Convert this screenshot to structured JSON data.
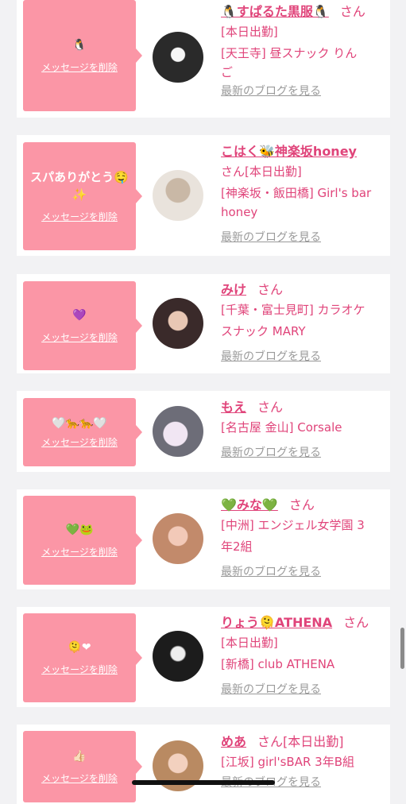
{
  "colors": {
    "accent": "#e0447a",
    "bubble": "#fb96a6",
    "muted": "#9a9a9a"
  },
  "common": {
    "delete_label": "メッセージを削除",
    "blog_label": "最新のブログを見る",
    "honorific": "さん"
  },
  "items": [
    {
      "message": "🐧",
      "name": "🐧すぱるた黒服🐧",
      "lines": [
        "[本日出勤]",
        "[天王寺] 昼スナック りん",
        "ご"
      ]
    },
    {
      "message": "スパありがとう🤤✨",
      "name": "こはく🐝神楽坂honey",
      "lines": [
        "さん[本日出勤]",
        "[神楽坂・飯田橋] Girl's bar",
        "honey"
      ]
    },
    {
      "message": "💜",
      "name": "みけ",
      "lines": [
        "[千葉・富士見町] カラオケ",
        "スナック MARY"
      ]
    },
    {
      "message": "🤍🐆🐆🤍",
      "name": "もえ",
      "lines": [
        "[名古屋 金山] Corsale"
      ]
    },
    {
      "message": "💚🐸",
      "name": "💚みな💚",
      "lines": [
        "[中洲] エンジェル女学園 3",
        "年2組"
      ]
    },
    {
      "message": "🫠❤",
      "name": "りょう🫠ATHENA",
      "lines": [
        "[本日出勤]",
        "[新橋] club ATHENA"
      ]
    },
    {
      "message": "👍🏻",
      "name": "めあ",
      "lines": [
        "さん[本日出勤]",
        "[江坂] girl'sBAR 3年B組"
      ]
    }
  ]
}
